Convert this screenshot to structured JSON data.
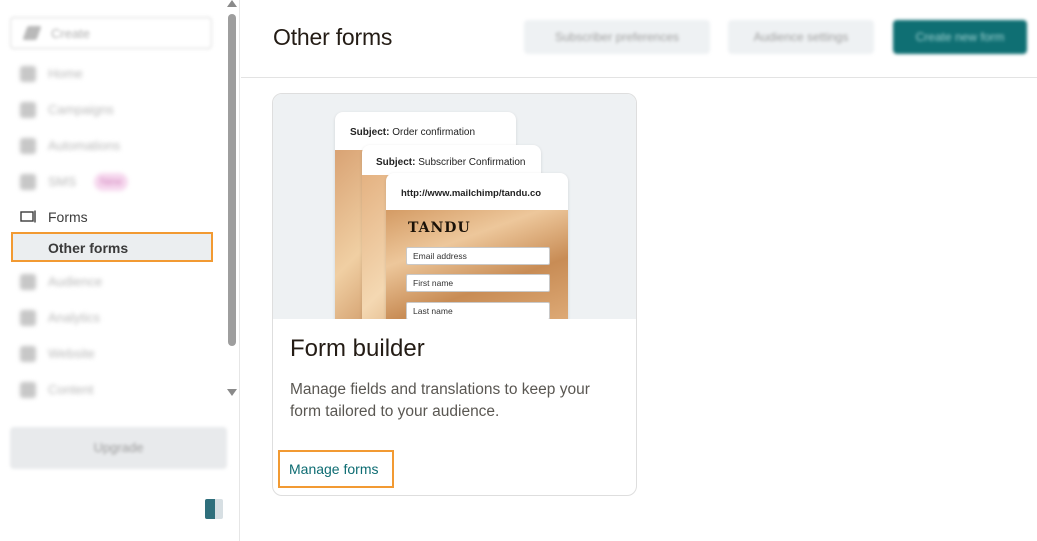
{
  "sidebar": {
    "create_label": "Create",
    "items": [
      {
        "label": "Home",
        "icon": "home-icon"
      },
      {
        "label": "Campaigns",
        "icon": "megaphone-icon"
      },
      {
        "label": "Automations",
        "icon": "automation-icon"
      },
      {
        "label": "SMS",
        "icon": "sms-icon",
        "badge": "New"
      }
    ],
    "forms_label": "Forms",
    "forms_icon": "form-icon",
    "selected_sub_label": "Other forms",
    "items_after": [
      {
        "label": "Audience",
        "icon": "audience-icon"
      },
      {
        "label": "Analytics",
        "icon": "analytics-icon"
      },
      {
        "label": "Website",
        "icon": "website-icon"
      },
      {
        "label": "Content",
        "icon": "content-icon"
      }
    ],
    "upgrade_label": "Upgrade",
    "highlight_color": "#f29a32"
  },
  "header": {
    "title": "Other forms",
    "buttons": {
      "subscriber_preferences": "Subscriber preferences",
      "audience_settings": "Audience settings",
      "create_new_form": "Create new form"
    }
  },
  "card": {
    "preview": {
      "subject1_prefix": "Subject:",
      "subject1_text": " Order confirmation",
      "subject2_prefix": "Subject:",
      "subject2_text": " Subscriber Confirmation",
      "url": "http://www.mailchimp/tandu.co",
      "brand": "TANDU",
      "fields": [
        "Email address",
        "First name",
        "Last name"
      ]
    },
    "title": "Form builder",
    "description": "Manage fields and translations to keep your form tailored to your audience.",
    "link_label": "Manage forms",
    "link_color": "#0d6c72"
  }
}
